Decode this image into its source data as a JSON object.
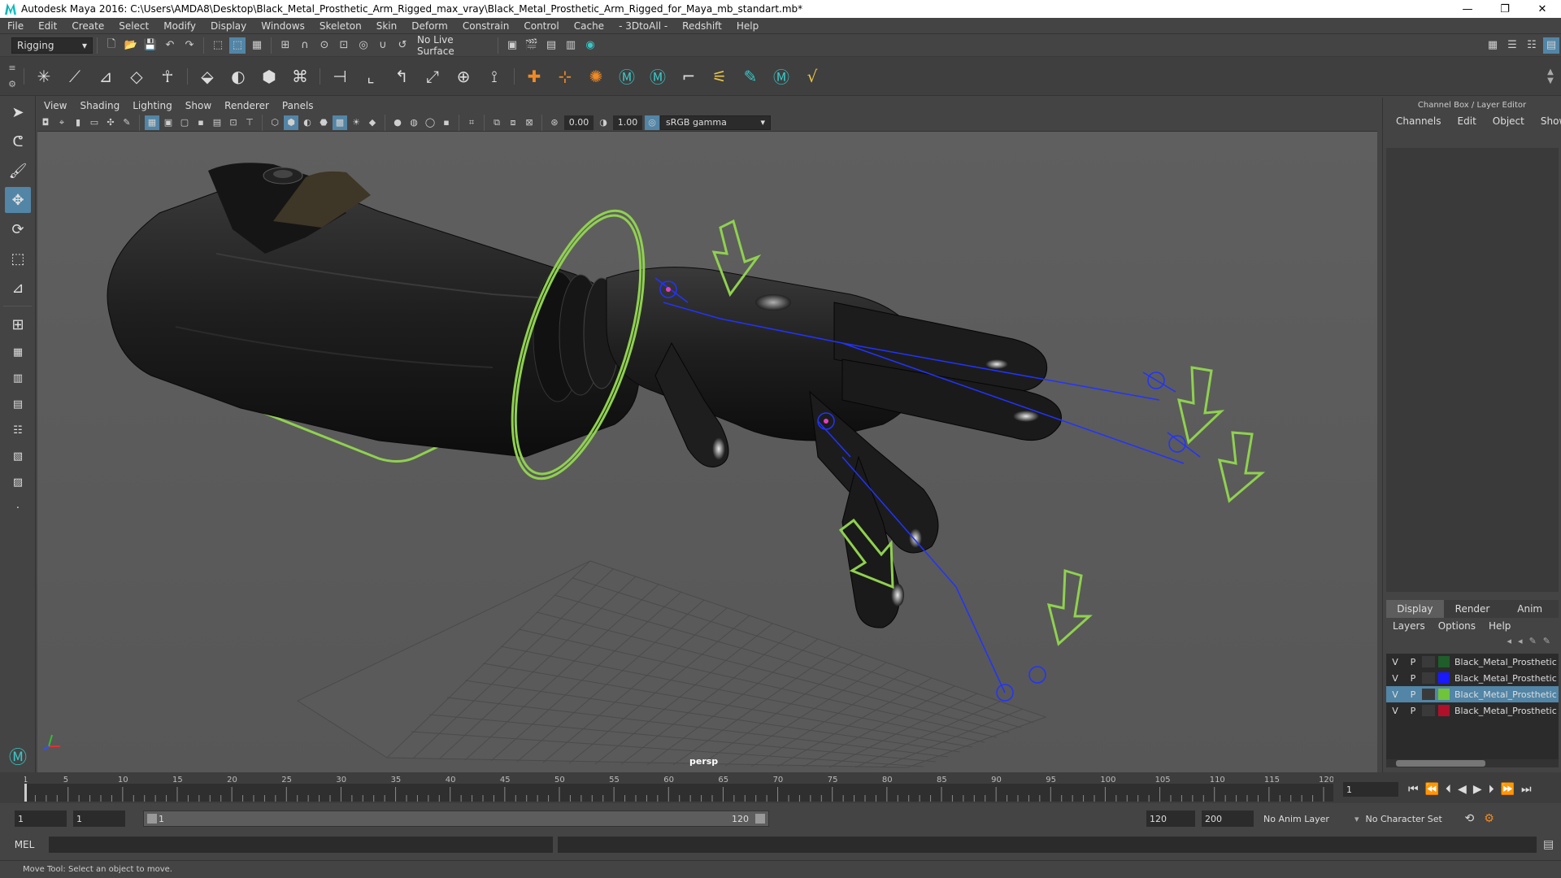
{
  "titlebar": {
    "title": "Autodesk Maya 2016: C:\\Users\\AMDA8\\Desktop\\Black_Metal_Prosthetic_Arm_Rigged_max_vray\\Black_Metal_Prosthetic_Arm_Rigged_for_Maya_mb_standart.mb*",
    "minimize": "—",
    "maximize": "❐",
    "close": "✕"
  },
  "menubar": [
    "File",
    "Edit",
    "Create",
    "Select",
    "Modify",
    "Display",
    "Windows",
    "Skeleton",
    "Skin",
    "Deform",
    "Constrain",
    "Control",
    "Cache",
    "- 3DtoAll -",
    "Redshift",
    "Help"
  ],
  "statusline": {
    "mode": "Rigging",
    "live_surface": "No Live Surface"
  },
  "viewport": {
    "menu": [
      "View",
      "Shading",
      "Lighting",
      "Show",
      "Renderer",
      "Panels"
    ],
    "exposure": "0.00",
    "gamma": "1.00",
    "color_space": "sRGB gamma",
    "camera": "persp"
  },
  "right_panel": {
    "title": "Channel Box / Layer Editor",
    "tabs": [
      "Channels",
      "Edit",
      "Object",
      "Show"
    ],
    "layer_tabs": [
      "Display",
      "Render",
      "Anim"
    ],
    "layer_menu": [
      "Layers",
      "Options",
      "Help"
    ],
    "layers": [
      {
        "v": "V",
        "p": "P",
        "name": "Black_Metal_Prosthetic",
        "color": "#1f5d2a",
        "selected": false
      },
      {
        "v": "V",
        "p": "P",
        "name": "Black_Metal_Prosthetic",
        "color": "#1a1aff",
        "selected": false
      },
      {
        "v": "V",
        "p": "P",
        "name": "Black_Metal_Prosthetic",
        "color": "#6fc43a",
        "selected": true
      },
      {
        "v": "V",
        "p": "P",
        "name": "Black_Metal_Prosthetic",
        "color": "#b0102a",
        "selected": false
      }
    ]
  },
  "timeline": {
    "ticks": [
      1,
      5,
      10,
      15,
      20,
      25,
      30,
      35,
      40,
      45,
      50,
      55,
      60,
      65,
      70,
      75,
      80,
      85,
      90,
      95,
      100,
      105,
      110,
      115,
      120
    ],
    "min": 1,
    "max": 120,
    "current_frame": "1"
  },
  "range": {
    "start": "1",
    "playback_start": "1",
    "slider_start": "1",
    "slider_end": "120",
    "playback_end": "120",
    "end": "200",
    "anim_layer": "No Anim Layer",
    "character_set": "No Character Set"
  },
  "mel": {
    "label": "MEL"
  },
  "helpline": {
    "text": "Move Tool: Select an object to move."
  }
}
